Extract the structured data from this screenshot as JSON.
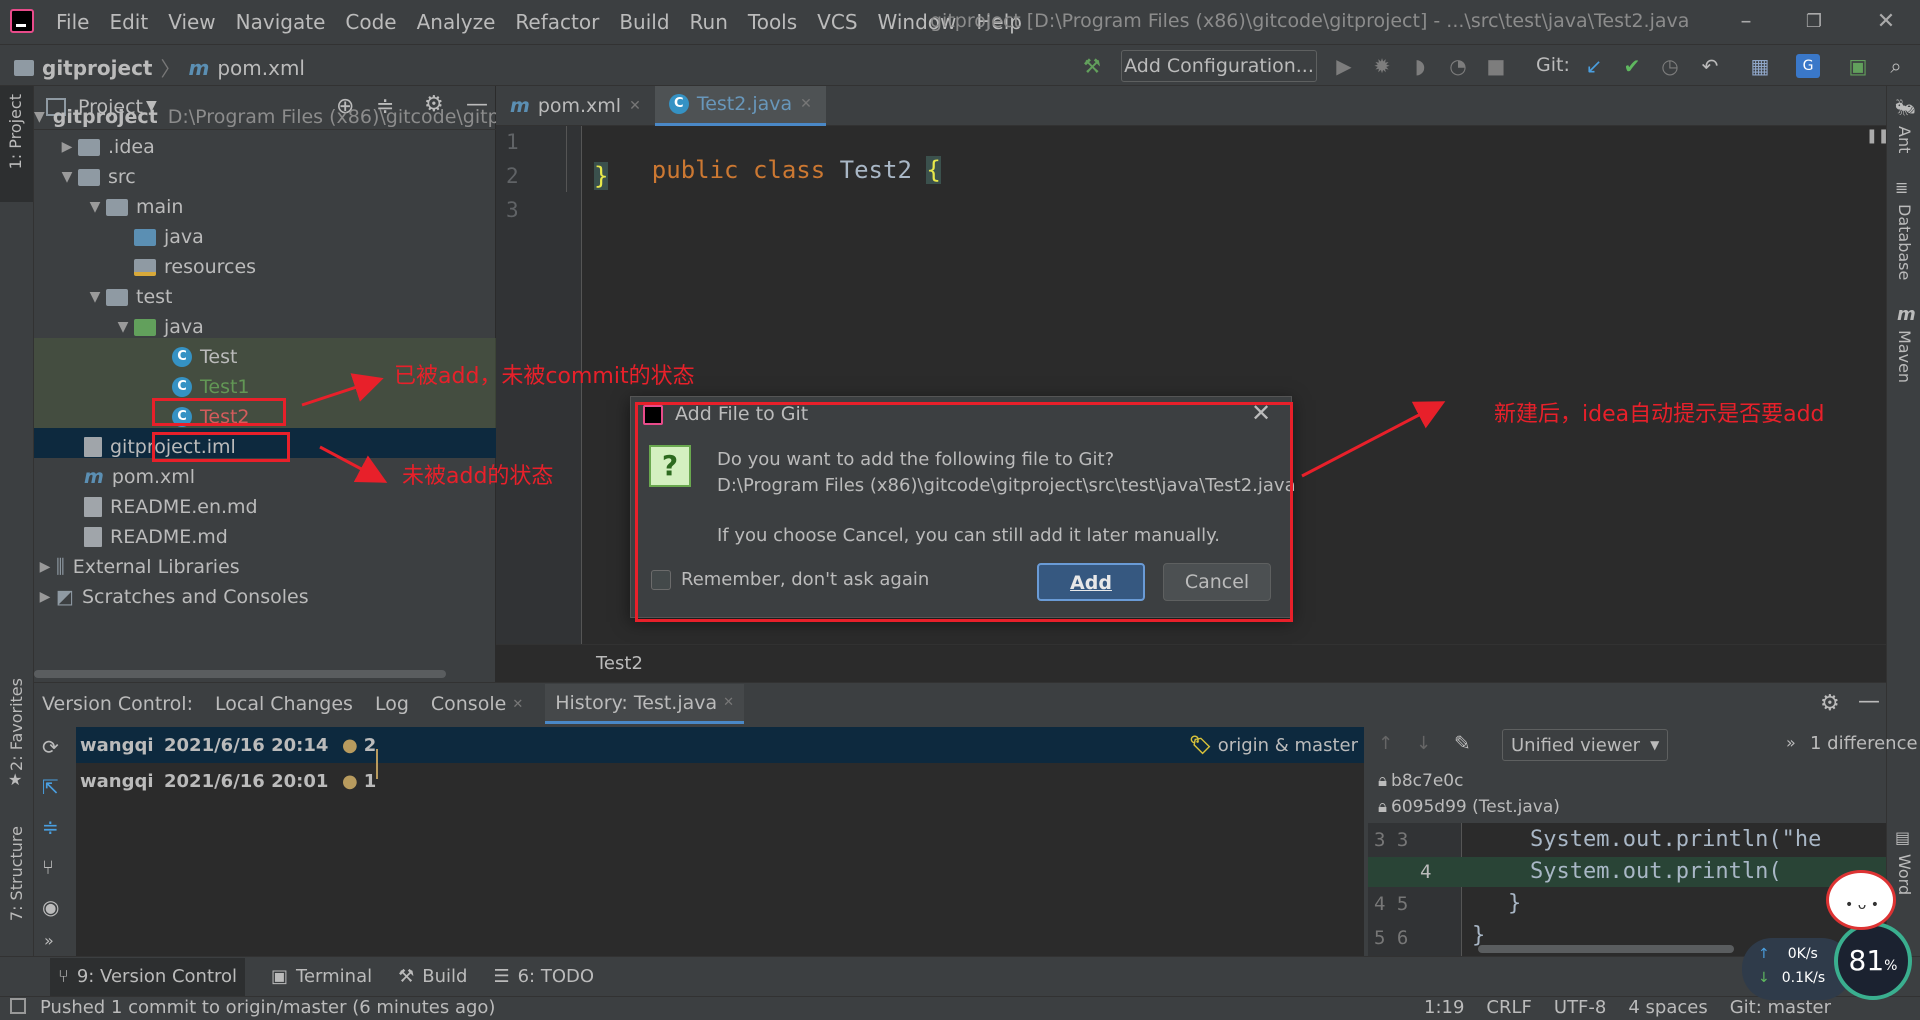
{
  "window": {
    "title": "gitproject [D:\\Program Files (x86)\\gitcode\\gitproject] - ...\\src\\test\\java\\Test2.java",
    "menu": [
      "File",
      "Edit",
      "View",
      "Navigate",
      "Code",
      "Analyze",
      "Refactor",
      "Build",
      "Run",
      "Tools",
      "VCS",
      "Window",
      "Help"
    ]
  },
  "navbar": {
    "project": "gitproject",
    "file": "pom.xml",
    "add_configuration": "Add Configuration...",
    "git_label": "Git:"
  },
  "left_stripe": {
    "project": "1: Project",
    "favorites": "2: Favorites",
    "structure": "7: Structure"
  },
  "right_stripe": {
    "ant": "Ant",
    "database": "Database",
    "maven": "Maven",
    "word": "Word"
  },
  "project_panel": {
    "title": "Project",
    "tree": [
      {
        "label": "gitproject",
        "path": "D:\\Program Files (x86)\\gitcode\\gitp"
      },
      {
        "label": ".idea"
      },
      {
        "label": "src"
      },
      {
        "label": "main"
      },
      {
        "label": "java"
      },
      {
        "label": "resources"
      },
      {
        "label": "test"
      },
      {
        "label": "java"
      },
      {
        "label": "Test"
      },
      {
        "label": "Test1"
      },
      {
        "label": "Test2"
      },
      {
        "label": "gitproject.iml"
      },
      {
        "label": "pom.xml"
      },
      {
        "label": "README.en.md"
      },
      {
        "label": "README.md"
      },
      {
        "label": "External Libraries"
      },
      {
        "label": "Scratches and Consoles"
      }
    ]
  },
  "editor": {
    "tabs": [
      {
        "label": "pom.xml"
      },
      {
        "label": "Test2.java"
      }
    ],
    "line_numbers": [
      "1",
      "2",
      "3"
    ],
    "line1": {
      "kw1": "public",
      "kw2": "class",
      "name": "Test2",
      "brace": "{"
    },
    "line2": "}",
    "breadcrumb": "Test2"
  },
  "dialog": {
    "title": "Add File to Git",
    "question": "Do you want to add the following file to Git?",
    "path": "D:\\Program Files (x86)\\gitcode\\gitproject\\src\\test\\java\\Test2.java",
    "hint": "If you choose Cancel, you can still add it later manually.",
    "remember": "Remember, don't ask again",
    "add": "Add",
    "cancel": "Cancel"
  },
  "vc_panel": {
    "label": "Version Control:",
    "tabs": [
      "Local Changes",
      "Log",
      "Console",
      "History: Test.java"
    ],
    "history": [
      {
        "author": "wangqi",
        "date": "2021/6/16 20:14",
        "rev": "2",
        "refs": "origin & master"
      },
      {
        "author": "wangqi",
        "date": "2021/6/16 20:01",
        "rev": "1",
        "refs": ""
      }
    ],
    "diff": {
      "viewer": "Unified viewer",
      "count": "1 difference",
      "rev_a": "b8c7e0c",
      "rev_b": "6095d99 (Test.java)",
      "lines": [
        {
          "num": "3 3",
          "text": "System.out.println(\"he"
        },
        {
          "num": "4",
          "text": "System.out.println("
        },
        {
          "num": "4 5",
          "text": "}"
        },
        {
          "num": "5 6",
          "text": "}"
        }
      ]
    }
  },
  "bottom_tools": [
    "9: Version Control",
    "Terminal",
    "Build",
    "6: TODO"
  ],
  "status": {
    "message": "Pushed 1 commit to origin/master (6 minutes ago)",
    "position": "1:19",
    "line_sep": "CRLF",
    "encoding": "UTF-8",
    "indent": "4 spaces",
    "branch": "Git: master"
  },
  "widget": {
    "up": "0K/s",
    "down": "0.1K/s",
    "percent": "81",
    "percent_unit": "%"
  },
  "annotations": {
    "added_not_committed": "已被add，未被commit的状态",
    "not_added": "未被add的状态",
    "prompt": "新建后，idea自动提示是否要add"
  },
  "colors": {
    "accent": "#365880",
    "annotation": "#e8202a",
    "added_file": "#629755",
    "keyword": "#cc7832"
  }
}
